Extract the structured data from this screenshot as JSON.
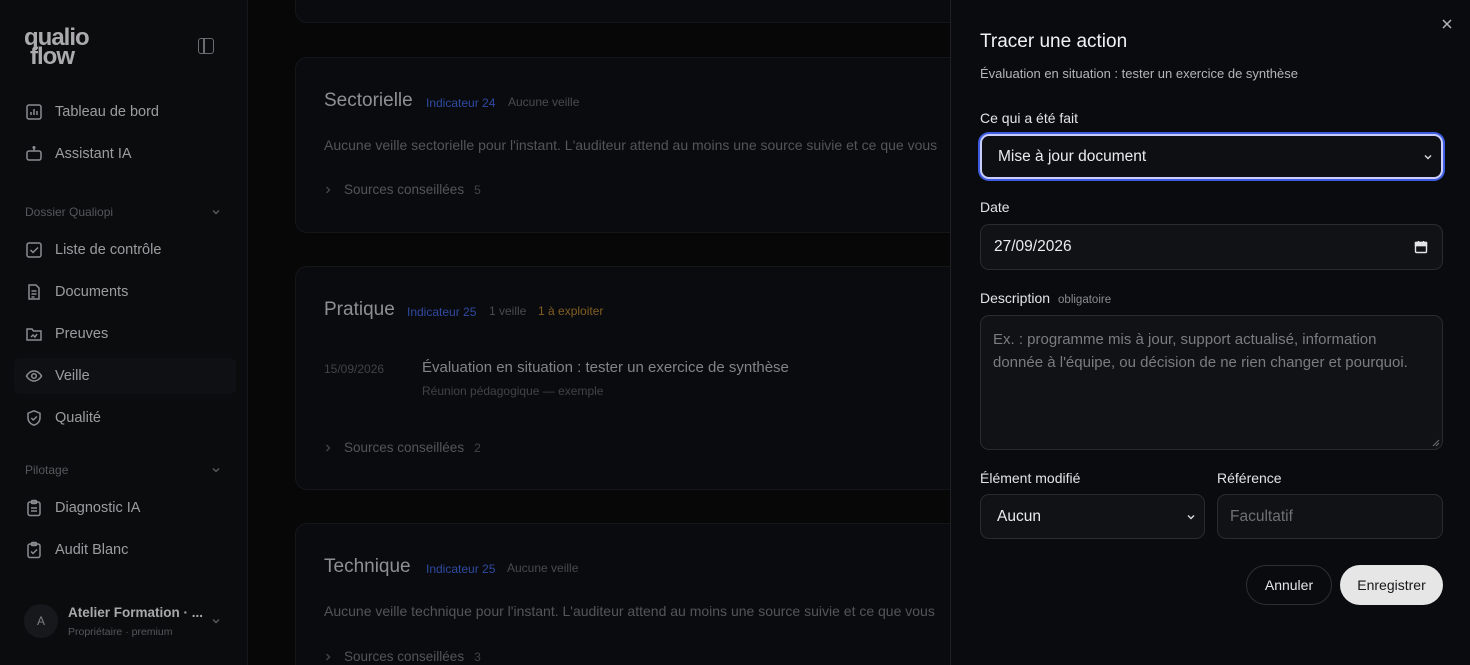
{
  "sidebar": {
    "logo": {
      "line1": "qualio",
      "line2": "flow"
    },
    "items_top": [
      {
        "label": "Tableau de bord",
        "icon": "chart-icon"
      },
      {
        "label": "Assistant IA",
        "icon": "bot-icon"
      }
    ],
    "sections": [
      {
        "label": "Dossier Qualiopi",
        "items": [
          {
            "label": "Liste de contrôle",
            "icon": "checkbox-icon"
          },
          {
            "label": "Documents",
            "icon": "document-icon"
          },
          {
            "label": "Preuves",
            "icon": "folder-icon"
          },
          {
            "label": "Veille",
            "icon": "eye-icon",
            "active": true
          },
          {
            "label": "Qualité",
            "icon": "shield-check-icon"
          }
        ]
      },
      {
        "label": "Pilotage",
        "items": [
          {
            "label": "Diagnostic IA",
            "icon": "clipboard-icon"
          },
          {
            "label": "Audit Blanc",
            "icon": "clipboard-check-icon"
          }
        ]
      }
    ],
    "user": {
      "initial": "A",
      "name": "Atelier Formation · ...",
      "role": "Propriétaire · premium"
    }
  },
  "main": {
    "cards": [
      {
        "title": "Sectorielle",
        "indicator": "Indicateur 24",
        "status": "Aucune veille",
        "text": "Aucune veille sectorielle pour l'instant. L'auditeur attend au moins une source suivie et ce que vous",
        "sources_label": "Sources conseillées",
        "sources_count": "5"
      },
      {
        "title": "Pratique",
        "indicator": "Indicateur 25",
        "status": "1 veille",
        "todo": "1 à exploiter",
        "entry": {
          "date": "15/09/2026",
          "title": "Évaluation en situation : tester un exercice de synthèse",
          "sub": "Réunion pédagogique — exemple"
        },
        "sources_label": "Sources conseillées",
        "sources_count": "2"
      },
      {
        "title": "Technique",
        "indicator": "Indicateur 25",
        "status": "Aucune veille",
        "text": "Aucune veille technique pour l'instant. L'auditeur attend au moins une source suivie et ce que vous",
        "sources_label": "Sources conseillées",
        "sources_count": "3"
      }
    ]
  },
  "drawer": {
    "title": "Tracer une action",
    "subtitle": "Évaluation en situation : tester un exercice de synthèse",
    "done_label": "Ce qui a été fait",
    "done_value": "Mise à jour document",
    "date_label": "Date",
    "date_value": "27/09/2026",
    "description_label": "Description",
    "description_hint": "obligatoire",
    "description_placeholder": "Ex. : programme mis à jour, support actualisé, information donnée à l'équipe, ou décision de ne rien changer et pourquoi.",
    "element_label": "Élément modifié",
    "element_value": "Aucun",
    "reference_label": "Référence",
    "reference_placeholder": "Facultatif",
    "cancel_label": "Annuler",
    "save_label": "Enregistrer"
  },
  "colors": {
    "accent": "#3d5ce0",
    "indicator": "#3c5fcf",
    "warning": "#a6782c"
  }
}
